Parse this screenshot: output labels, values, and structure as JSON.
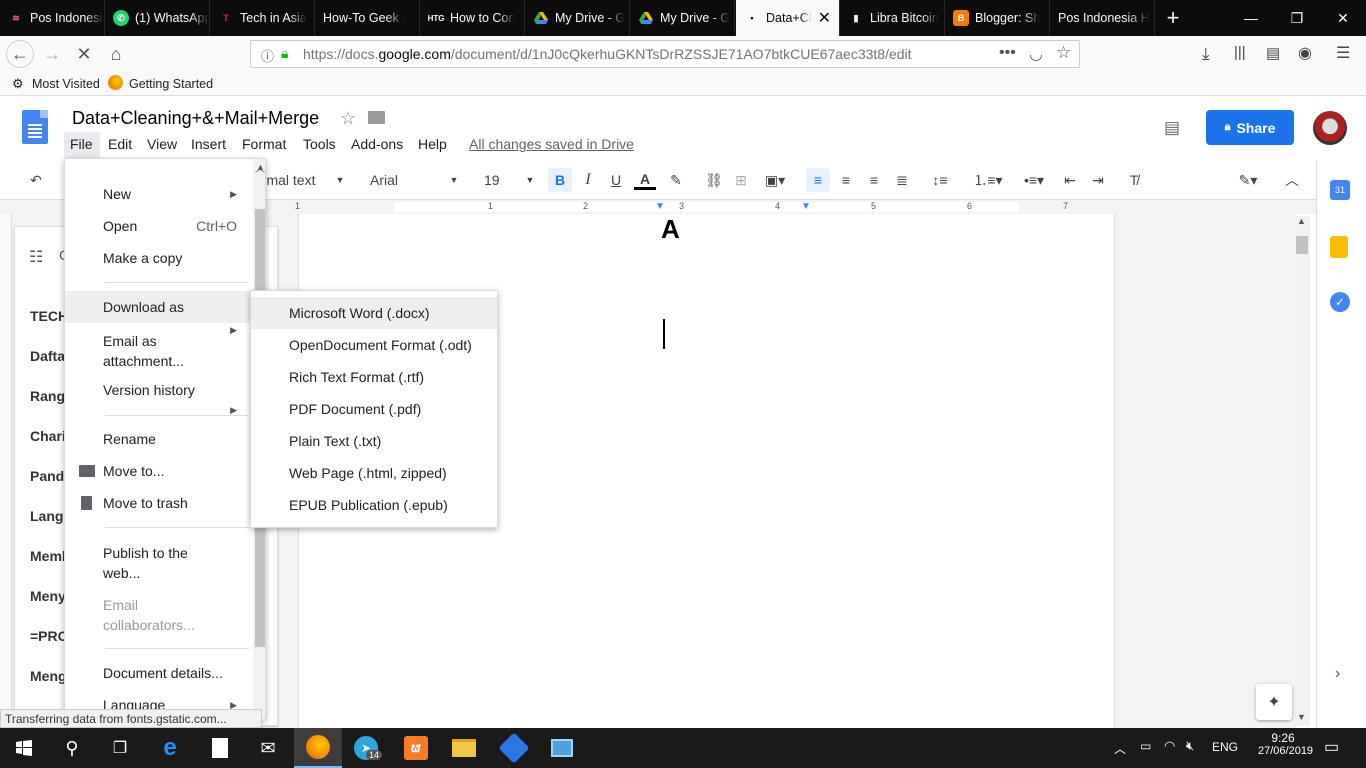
{
  "browser": {
    "tabs": [
      {
        "title": "Pos Indonesia",
        "icon": "pos-indonesia-icon",
        "active": false
      },
      {
        "title": "(1) WhatsApp",
        "icon": "whatsapp-icon",
        "active": false
      },
      {
        "title": "Tech in Asia",
        "icon": "techinasia-icon",
        "active": false
      },
      {
        "title": "How-To Geek -",
        "icon": "blank-icon",
        "active": false
      },
      {
        "title": "How to Con",
        "icon": "htg-icon",
        "active": false
      },
      {
        "title": "My Drive - G",
        "icon": "drive-icon",
        "active": false
      },
      {
        "title": "My Drive - G",
        "icon": "drive-icon",
        "active": false
      },
      {
        "title": "Data+Cl",
        "icon": "dot-icon",
        "active": true
      },
      {
        "title": "Libra Bitcoin",
        "icon": "libra-icon",
        "active": false
      },
      {
        "title": "Blogger: Sh",
        "icon": "blogger-icon",
        "active": false
      },
      {
        "title": "Pos Indonesia H",
        "icon": "blank-icon",
        "active": false
      }
    ],
    "url_prefix": "https://docs.",
    "url_domain": "google.com",
    "url_path": "/document/d/1nJ0cQkerhuGKNTsDrRZSSJE71AO7btkCUE67aec33t8/edit",
    "bookmarks": [
      {
        "label": "Most Visited",
        "icon": "gear-icon"
      },
      {
        "label": "Getting Started",
        "icon": "firefox-icon"
      }
    ]
  },
  "docs": {
    "title": "Data+Cleaning+&+Mail+Merge",
    "menus": [
      "File",
      "Edit",
      "View",
      "Insert",
      "Format",
      "Tools",
      "Add-ons",
      "Help"
    ],
    "saved_status": "All changes saved in Drive",
    "share_label": "Share",
    "toolbar": {
      "style": "ormal text",
      "font": "Arial",
      "size": "19",
      "bold": "B",
      "italic": "I",
      "underline": "U",
      "text_color": "A"
    },
    "ruler_numbers": [
      "1",
      "1",
      "2",
      "3",
      "4",
      "5",
      "6",
      "7"
    ],
    "page_heading": "A",
    "outline_items": [
      "TECH",
      "Dafta",
      "Rangl",
      "Chari",
      "Pandu",
      "Langk",
      "Memb",
      "Meny",
      "=PRO",
      "Meng"
    ],
    "outline_letter": "C"
  },
  "file_menu": {
    "items": [
      {
        "label": "New",
        "shortcut": "",
        "submenu": true
      },
      {
        "label": "Open",
        "shortcut": "Ctrl+O"
      },
      {
        "label": "Make a copy"
      },
      {
        "label": "Download as",
        "submenu": true
      },
      {
        "label": "Email as attachment..."
      },
      {
        "label": "Version history",
        "submenu": true
      },
      {
        "label": "Rename"
      },
      {
        "label": "Move to..."
      },
      {
        "label": "Move to trash"
      },
      {
        "label": "Publish to the web..."
      },
      {
        "label": "Email collaborators...",
        "disabled": true
      },
      {
        "label": "Document details..."
      },
      {
        "label": "Language",
        "submenu": true
      }
    ]
  },
  "download_menu": {
    "items": [
      "Microsoft Word (.docx)",
      "OpenDocument Format (.odt)",
      "Rich Text Format (.rtf)",
      "PDF Document (.pdf)",
      "Plain Text (.txt)",
      "Web Page (.html, zipped)",
      "EPUB Publication (.epub)"
    ]
  },
  "status": "Transferring data from fonts.gstatic.com...",
  "taskbar": {
    "lang": "ENG",
    "time": "9:26",
    "date": "27/06/2019",
    "telegram_badge": "14"
  },
  "colors": {
    "share_blue": "#1a73e8",
    "docs_blue": "#4285f4",
    "hover_gray": "#f1f3f4"
  }
}
